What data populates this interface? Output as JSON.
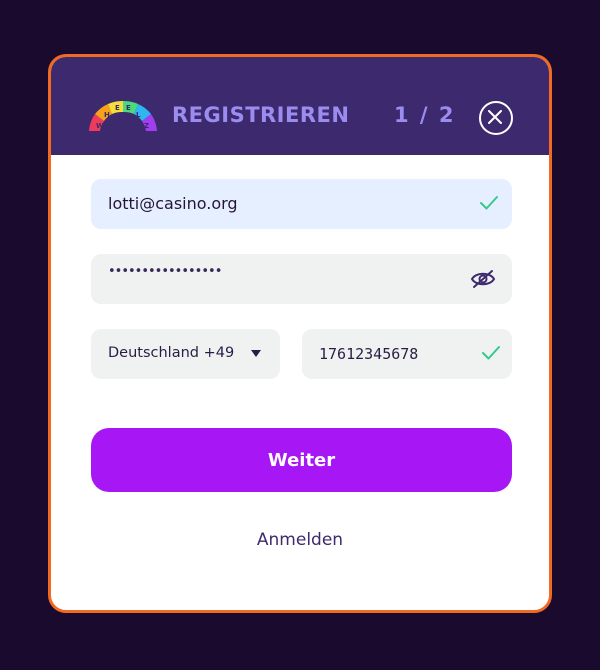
{
  "header": {
    "title": "REGISTRIEREN",
    "step": "1 / 2",
    "logo_name": "wheelz-logo",
    "close_icon": "close-icon"
  },
  "form": {
    "email": {
      "value": "lotti@casino.org",
      "valid": true
    },
    "password": {
      "masked_value": "•••••••••••••••••",
      "toggle_icon": "eye-slash-icon"
    },
    "country": {
      "value": "Deutschland +49"
    },
    "phone": {
      "value": "17612345678",
      "valid": true
    }
  },
  "actions": {
    "submit_label": "Weiter",
    "login_label": "Anmelden"
  },
  "colors": {
    "background": "#1a0a2e",
    "header": "#3d2a6e",
    "accent_border": "#f26a22",
    "primary_button": "#a716f4",
    "valid_check": "#35c98a"
  }
}
